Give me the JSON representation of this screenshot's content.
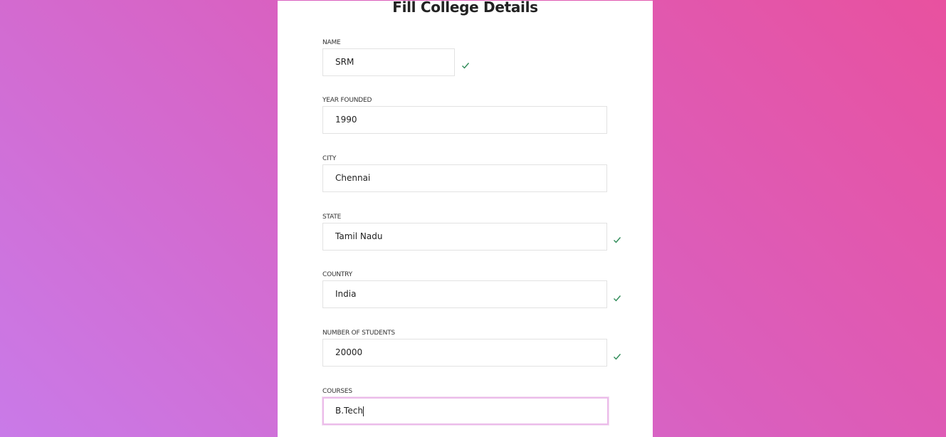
{
  "form": {
    "title": "Fill College Details",
    "fields": [
      {
        "label": "NAME",
        "value": "SRM",
        "valid": true
      },
      {
        "label": "YEAR FOUNDED",
        "value": "1990",
        "valid": false
      },
      {
        "label": "CITY",
        "value": "Chennai",
        "valid": false
      },
      {
        "label": "STATE",
        "value": "Tamil Nadu",
        "valid": true
      },
      {
        "label": "COUNTRY",
        "value": "India",
        "valid": true
      },
      {
        "label": "NUMBER OF STUDENTS",
        "value": "20000",
        "valid": true
      },
      {
        "label": "COURSES",
        "value": "B.Tech",
        "valid": false,
        "focused": true
      }
    ]
  },
  "colors": {
    "check": "#2e8b57",
    "focus_border": "#ecbcea",
    "gradient_start": "#e8519f",
    "gradient_end": "#c97ae8"
  }
}
